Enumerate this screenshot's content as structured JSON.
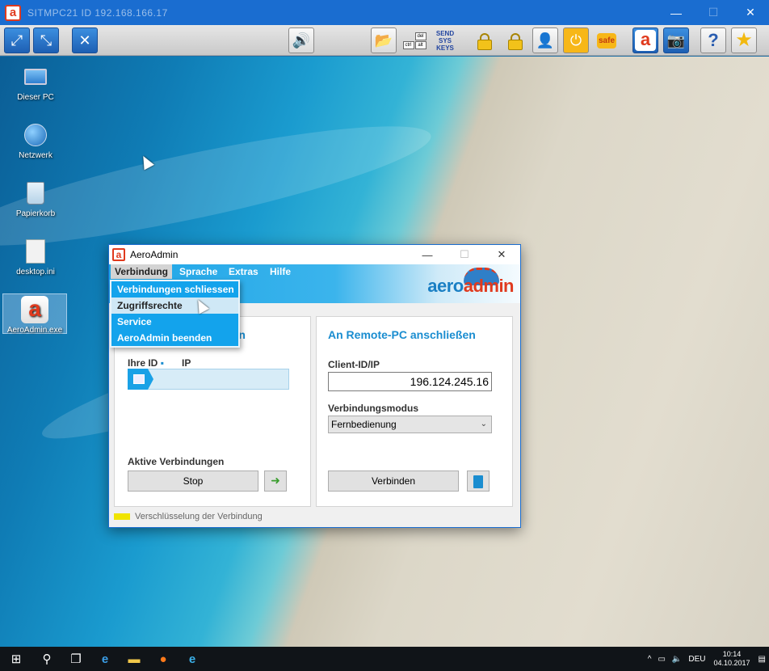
{
  "outer_window": {
    "title": "SITMPC21 ID 192.168.166.17",
    "controls": {
      "minimize": "—",
      "maximize": "☐",
      "close": "✕"
    }
  },
  "toolbar": {
    "buttons": [
      {
        "id": "fullscreen",
        "icon": "fullscreen-icon",
        "glyph": "⤢"
      },
      {
        "id": "fit-screen",
        "icon": "fit-screen-icon",
        "glyph": "⤡"
      },
      {
        "id": "settings",
        "icon": "tools-icon",
        "glyph": "✕"
      },
      {
        "id": "sound",
        "icon": "speaker-icon",
        "glyph": "🔊"
      },
      {
        "id": "file-transfer",
        "icon": "folder-transfer-icon",
        "glyph": "📂"
      },
      {
        "id": "ctrl-alt-del",
        "icon": "keys-icon"
      },
      {
        "id": "send-sys-keys",
        "icon": "send-sys-keys-icon"
      },
      {
        "id": "lock-input",
        "icon": "lock-icon"
      },
      {
        "id": "lock-sound",
        "icon": "lock-speaker-icon"
      },
      {
        "id": "logoff-user",
        "icon": "user-logoff-icon",
        "glyph": "👤"
      },
      {
        "id": "restart",
        "icon": "restart-icon",
        "glyph": "⏻"
      },
      {
        "id": "safe-mode",
        "icon": "safe-icon"
      },
      {
        "id": "aeroadmin",
        "icon": "aeroadmin-logo-icon"
      },
      {
        "id": "screenshot",
        "icon": "camera-icon",
        "glyph": "📷"
      },
      {
        "id": "help",
        "icon": "help-icon",
        "glyph": "?"
      },
      {
        "id": "favorite",
        "icon": "star-icon",
        "glyph": "★"
      }
    ],
    "keys_labels": [
      "del",
      "ctrl",
      "alt"
    ],
    "send_sys_keys": [
      "SEND",
      "SYS",
      "KEYS"
    ],
    "safe_label": "safe",
    "aero_letter": "a"
  },
  "desktop_icons": [
    {
      "label": "Dieser PC",
      "icon": "computer-icon"
    },
    {
      "label": "Netzwerk",
      "icon": "network-icon"
    },
    {
      "label": "Papierkorb",
      "icon": "recycle-bin-icon"
    },
    {
      "label": "desktop.ini",
      "icon": "file-icon"
    },
    {
      "label": "AeroAdmin.exe",
      "icon": "aeroadmin-icon",
      "letter": "a"
    }
  ],
  "aeroadmin": {
    "title": "AeroAdmin",
    "logo_letter": "a",
    "menu": [
      {
        "label": "Verbindung",
        "active": true
      },
      {
        "label": "Sprache"
      },
      {
        "label": "Extras"
      },
      {
        "label": "Hilfe"
      }
    ],
    "brand": {
      "part1": "aero",
      "part2": "admin"
    },
    "dropdown": [
      {
        "label": "Verbindungen schliessen"
      },
      {
        "label": "Zugriffsrechte",
        "hover": true
      },
      {
        "label": "Service"
      },
      {
        "label": "AeroAdmin beenden"
      }
    ],
    "left_panel": {
      "title_visible": "ssen",
      "id_label": "Ihre ID",
      "id_dot": "▪",
      "ip_label": "IP",
      "active_connections": "Aktive Verbindungen",
      "stop_button": "Stop"
    },
    "right_panel": {
      "title": "An Remote-PC anschließen",
      "client_label": "Client-ID/IP",
      "client_value": "196.124.245.16",
      "mode_label": "Verbindungsmodus",
      "mode_value": "Fernbedienung",
      "connect_button": "Verbinden"
    },
    "status_text": "Verschlüsselung der Verbindung",
    "status_color": "#f0e400"
  },
  "taskbar": {
    "items": [
      "windows-start-icon",
      "search-icon",
      "task-view-icon",
      "edge-icon",
      "file-explorer-icon",
      "firefox-icon",
      "ie-icon"
    ],
    "tray": {
      "language": "DEU",
      "time": "10:14",
      "date": "04.10.2017"
    }
  }
}
